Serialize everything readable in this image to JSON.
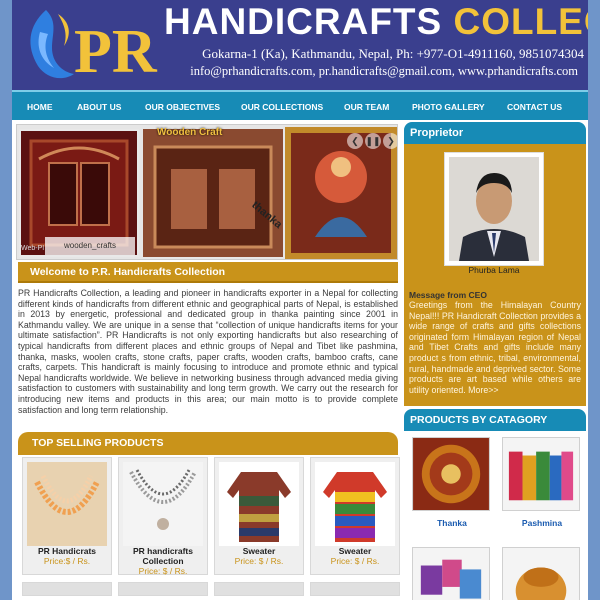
{
  "header": {
    "logo_text": "PR",
    "title_part1": "HANDICRAFTS",
    "title_part2": "COLLECTION",
    "address": "Gokarna-1 (Ka), Kathmandu, Nepal,  Ph: +977-O1-4911160, 9851074304",
    "contact": "info@prhandicrafts.com, pr.handicrafts@gmail.com, www.prhandicrafts.com"
  },
  "nav": {
    "items": [
      {
        "label": "HOME"
      },
      {
        "label": "ABOUT US"
      },
      {
        "label": "OUR OBJECTIVES"
      },
      {
        "label": "OUR COLLECTIONS"
      },
      {
        "label": "OUR TEAM"
      },
      {
        "label": "PHOTO GALLERY"
      },
      {
        "label": "CONTACT US"
      }
    ]
  },
  "slider": {
    "caption_a": "wooden_crafts",
    "caption_b": "Wooden Craft",
    "caption_c": "thanka",
    "number": "Web-PI"
  },
  "welcome": {
    "heading": "Welcome to P.R. Handicrafts Collection",
    "text": "PR Handicrafts Collection, a leading and pioneer in handicrafts exporter in a Nepal for collecting different kinds of handicrafts from different ethnic and geographical parts of Nepal, is established in 2013 by energetic, professional and dedicated group in thanka painting since 2001 in Kathmandu valley. We are unique in a sense that “collection of unique handicrafts items for your ultimate satisfaction”. PR Handicrafts is not only exporting handicrafts but also researching of typical handicrafts from different places and ethnic groups of Nepal and Tibet like pashmina, thanka, masks, woolen crafts, stone crafts, paper crafts, wooden crafts, bamboo crafts, cane crafts, carpets. This handicraft is mainly focusing to introduce and promote ethnic and typical Nepal handicrafts worldwide. We believe in networking business through advanced media giving satisfaction to customers with sustainability and long term growth. We carry out the research for introducing new items and products in this area; our main motto is to provide complete satisfaction and long term relationship."
  },
  "top_selling": {
    "heading": "TOP SELLING PRODUCTS",
    "products": [
      {
        "name": "PR Handicrats",
        "price": "Price:$ / Rs."
      },
      {
        "name": "PR handicrafts Collection",
        "price": "Price: $ / Rs."
      },
      {
        "name": "Sweater",
        "price": "Price: $ / Rs."
      },
      {
        "name": "Sweater",
        "price": "Price: $ / Rs."
      }
    ]
  },
  "proprietor": {
    "heading": "Proprietor",
    "name": "Phurba Lama",
    "message_title": "Message from CEO",
    "message": "Greetings from the Himalayan Country Nepal!!! PR Handicraft Collection provides a wide range of crafts and gifts collections originated form Himalayan region of Nepal and Tibet Crafts and gifts include many product s from ethnic, tribal, environmental, rural, handmade and deprived sector. Some products are art based while others are utility oriented. More>>"
  },
  "categories": {
    "heading": "PRODUCTS BY CATAGORY",
    "items": [
      {
        "label": "Thanka"
      },
      {
        "label": "Pashmina"
      },
      {
        "label": ""
      },
      {
        "label": ""
      }
    ]
  },
  "colors": {
    "header_bg": "#3a3f8e",
    "nav_bg": "#178bb6",
    "accent_gold": "#c9931a",
    "title_gold": "#f2c23a",
    "page_bg": "#6f95c9"
  }
}
